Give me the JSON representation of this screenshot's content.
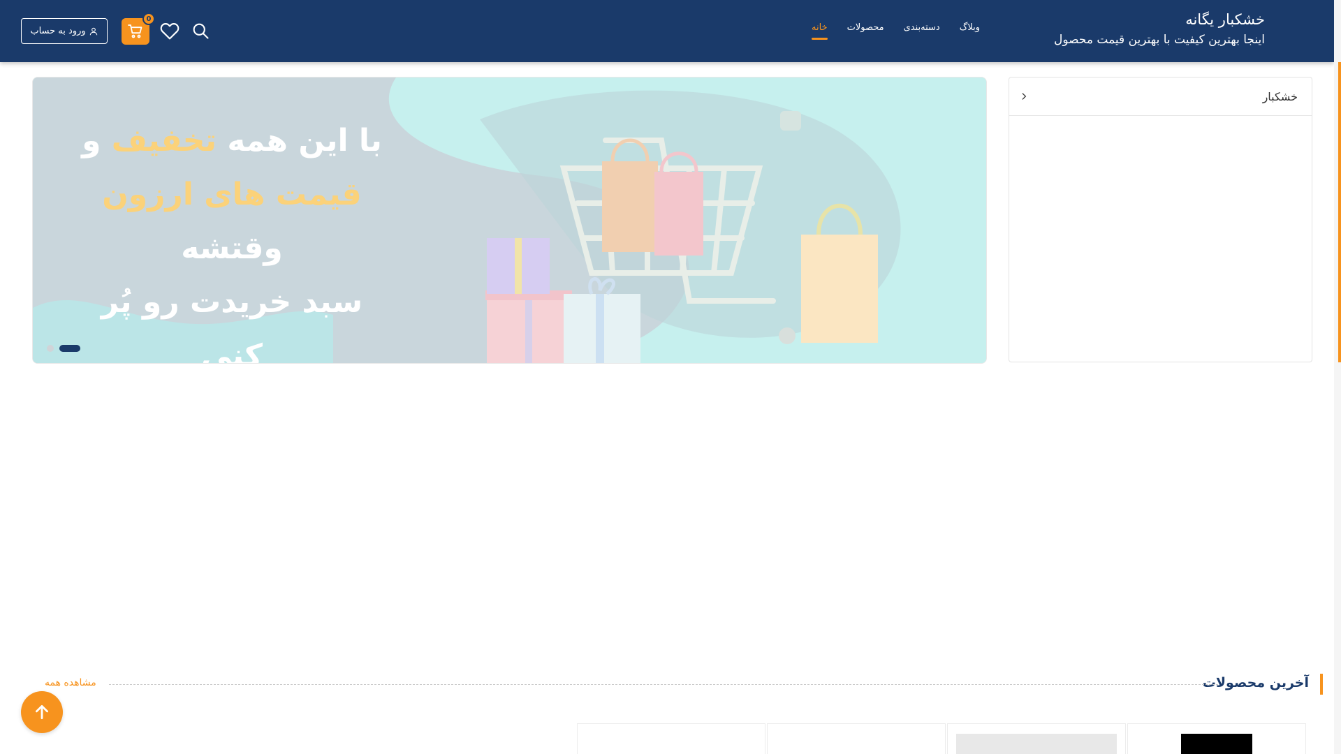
{
  "brand": {
    "title": "خشکبار یگانه",
    "subtitle": "اینجا بهترین کیفیت با بهترین قیمت محصول"
  },
  "nav": {
    "items": [
      {
        "label": "خانه",
        "active": true
      },
      {
        "label": "محصولات",
        "active": false
      },
      {
        "label": "دسته‌بندی",
        "active": false
      },
      {
        "label": "وبلاگ",
        "active": false
      }
    ]
  },
  "header": {
    "login_label": "ورود به حساب",
    "cart_count": "0",
    "icons": [
      "user-icon",
      "cart-icon",
      "heart-icon",
      "search-icon"
    ]
  },
  "sidebar": {
    "category_label": "خشکبار",
    "icon": "chevron-right-icon"
  },
  "banner": {
    "line1_a": "با این همه",
    "line1_hl": "تخفیف",
    "line1_b": "و",
    "line2_hl": "قیمت های ارزون",
    "line2_b": "وقتشه",
    "line3": "سبد خریدت رو پُر کنی",
    "slides": 2,
    "active_slide": 2
  },
  "latest": {
    "title": "آخرین محصولات",
    "view_all": "مشاهده همه"
  },
  "colors": {
    "primary": "#1a3a6a",
    "accent": "#f7931e",
    "highlight": "#fbd27a",
    "banner_bg": "#c4f0ee"
  }
}
